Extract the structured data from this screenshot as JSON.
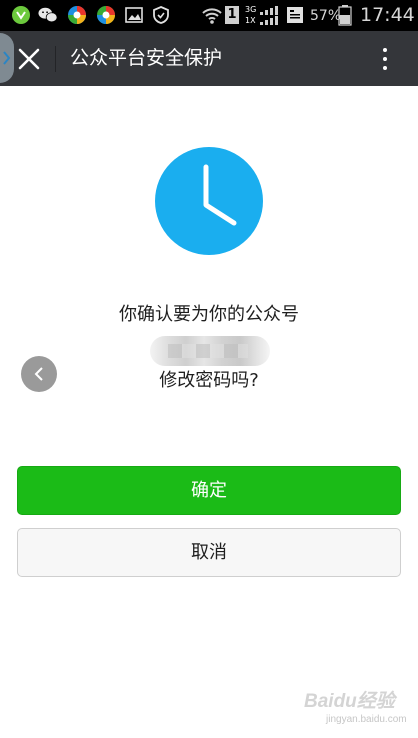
{
  "status_bar": {
    "sim_slot": "1",
    "network_top": "3G",
    "network_bottom": "1X",
    "battery_percent": "57%",
    "time": "17:44",
    "icons": [
      "app-store-icon",
      "wechat-icon",
      "browser-icon",
      "browser-alt-icon",
      "gallery-icon",
      "shield-icon",
      "wifi-icon",
      "sim-icon",
      "signal-icon",
      "data-icon",
      "battery-icon"
    ]
  },
  "title_bar": {
    "title": "公众平台安全保护",
    "close_icon": "close-icon",
    "more_icon": "more-vertical-icon",
    "background": "#34363a"
  },
  "content": {
    "icon": "clock-icon",
    "icon_color": "#1aaeef",
    "confirm_line": "你确认要为你的公众号",
    "change_line": "修改密码吗?"
  },
  "buttons": {
    "confirm_label": "确定",
    "cancel_label": "取消",
    "confirm_color": "#1bbb17"
  },
  "watermark": {
    "line1": "Baidu经验",
    "line2": "jingyan.baidu.com"
  }
}
